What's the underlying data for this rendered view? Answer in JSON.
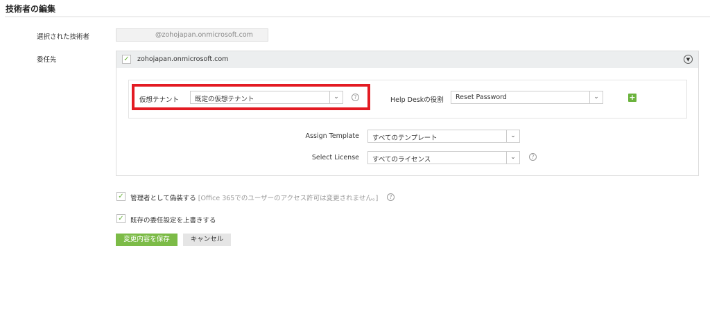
{
  "page": {
    "title": "技術者の編集"
  },
  "form": {
    "selected_tech_label": "選択された技術者",
    "selected_tech_value": "@zohojapan.onmicrosoft.com",
    "delegate_label": "委任先",
    "domain": "zohojapan.onmicrosoft.com",
    "virtual_tenant_label": "仮想テナント",
    "virtual_tenant_value": "既定の仮想テナント",
    "helpdesk_role_label": "Help Deskの役割",
    "helpdesk_role_value": "Reset Password",
    "assign_template_label": "Assign Template",
    "assign_template_value": "すべてのテンプレート",
    "select_license_label": "Select License",
    "select_license_value": "すべてのライセンス",
    "impersonate_label": "管理者として偽装する",
    "impersonate_note": "[Office 365でのユーザーのアクセス許可は変更されません。]",
    "overwrite_label": "既存の委任設定を上書きする",
    "save_label": "変更内容を保存",
    "cancel_label": "キャンセル"
  },
  "colors": {
    "accent": "#7cbb47",
    "highlight": "#e31b23"
  }
}
